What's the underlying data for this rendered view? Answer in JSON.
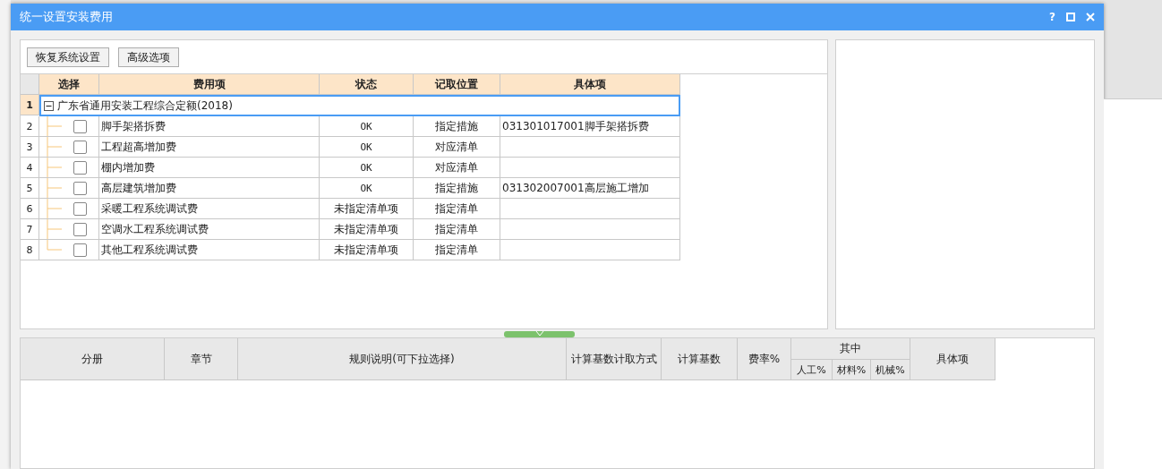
{
  "window": {
    "title": "统一设置安装费用",
    "help": "?"
  },
  "toolbar": {
    "buttons": [
      "恢复系统设置",
      "高级选项"
    ]
  },
  "fee_table": {
    "columns": [
      "选择",
      "费用项",
      "状态",
      "记取位置",
      "具体项"
    ],
    "group": {
      "number": "1",
      "label": "广东省通用安装工程综合定额(2018)",
      "expanded": true,
      "selected": true
    },
    "rows": [
      {
        "number": "2",
        "checked": false,
        "selected": false,
        "item": "脚手架搭拆费",
        "status": "OK",
        "position": "指定措施",
        "detail": "031301017001脚手架搭拆费"
      },
      {
        "number": "3",
        "checked": false,
        "selected": false,
        "item": "工程超高增加费",
        "status": "OK",
        "position": "对应清单"
      },
      {
        "number": "4",
        "checked": false,
        "selected": false,
        "item": "棚内增加费",
        "status": "OK",
        "position": "对应清单"
      },
      {
        "number": "5",
        "checked": false,
        "selected": false,
        "item": "高层建筑增加费",
        "status": "OK",
        "position": "指定措施",
        "detail": "031302007001高层施工增加"
      },
      {
        "number": "6",
        "checked": false,
        "selected": false,
        "item": "采暖工程系统调试费",
        "status": "未指定清单项",
        "position": "指定清单"
      },
      {
        "number": "7",
        "checked": false,
        "selected": false,
        "item": "空调水工程系统调试费",
        "status": "未指定清单项",
        "position": "指定清单"
      },
      {
        "number": "8",
        "checked": false,
        "selected": false,
        "item": "其他工程系统调试费",
        "status": "未指定清单项",
        "position": "指定清单"
      }
    ]
  },
  "rule_table": {
    "columns": [
      "分册",
      "章节",
      "规则说明(可下拉选择)",
      "计算基数计取方式",
      "计算基数",
      "费率%"
    ],
    "group_header": "其中",
    "sub_columns": [
      "人工%",
      "材料%",
      "机械%"
    ],
    "last_column": "具体项"
  }
}
